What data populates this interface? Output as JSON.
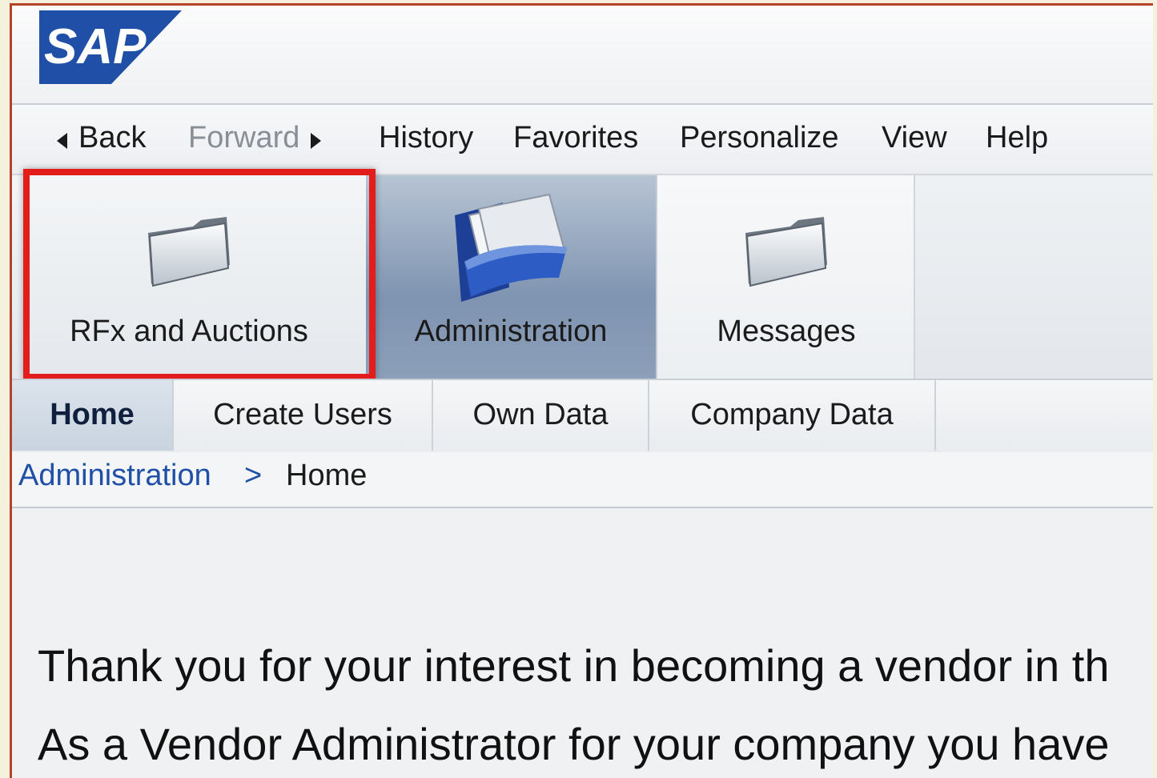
{
  "colors": {
    "highlight": "#e31c1c",
    "link": "#1f4fa6",
    "sap_blue": "#1f4fa6"
  },
  "logo": {
    "text": "SAP",
    "icon": "sap-logo"
  },
  "menu": {
    "back": "Back",
    "forward": "Forward",
    "history": "History",
    "favorites": "Favorites",
    "personalize": "Personalize",
    "view": "View",
    "help": "Help"
  },
  "work_centers": [
    {
      "label": "RFx and Auctions",
      "icon": "folder-icon",
      "highlighted": true
    },
    {
      "label": "Administration",
      "icon": "documents-folder-icon",
      "selected": true
    },
    {
      "label": "Messages",
      "icon": "folder-icon"
    }
  ],
  "subnav": {
    "home": "Home",
    "create_users": "Create Users",
    "own_data": "Own Data",
    "company_data": "Company Data"
  },
  "breadcrumb": {
    "parent": "Administration",
    "separator": ">",
    "current": "Home"
  },
  "content": {
    "line1": "Thank you for your interest in becoming a vendor in th",
    "line2": "As a Vendor Administrator for your company you have"
  }
}
